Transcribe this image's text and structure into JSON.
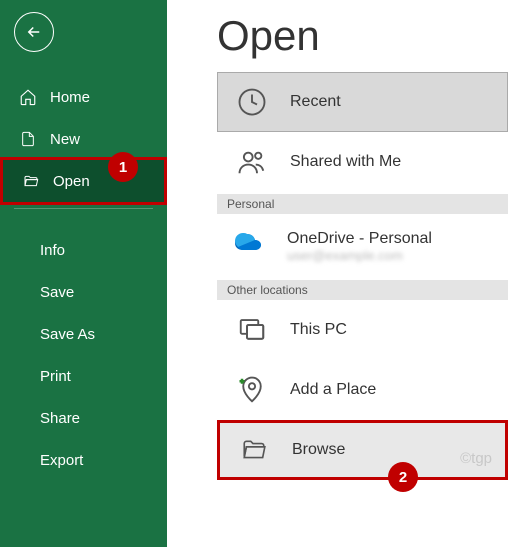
{
  "sidebar": {
    "home": "Home",
    "new": "New",
    "open": "Open",
    "info": "Info",
    "save": "Save",
    "saveAs": "Save As",
    "print": "Print",
    "share": "Share",
    "export": "Export"
  },
  "main": {
    "title": "Open",
    "recent": "Recent",
    "sharedWithMe": "Shared with Me",
    "personalHeader": "Personal",
    "onedrive": {
      "title": "OneDrive - Personal",
      "sub": "user@example.com"
    },
    "otherHeader": "Other locations",
    "thisPC": "This PC",
    "addPlace": "Add a Place",
    "browse": "Browse"
  },
  "badges": {
    "one": "1",
    "two": "2"
  },
  "watermark": "©tgp"
}
